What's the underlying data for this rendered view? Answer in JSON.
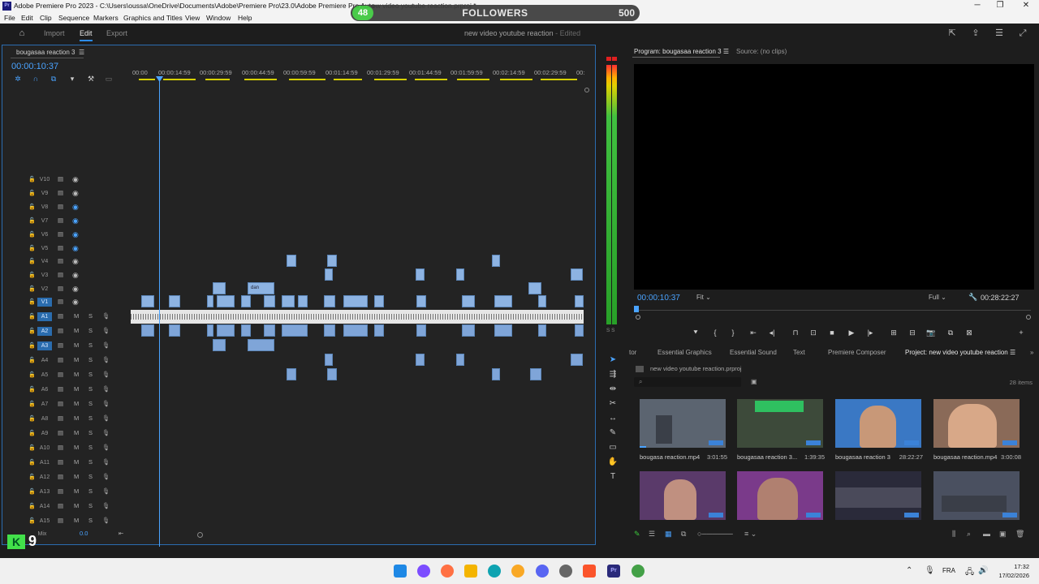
{
  "window": {
    "title": "Adobe Premiere Pro 2023 - C:\\Users\\oussa\\OneDrive\\Documents\\Adobe\\Premiere Pro\\23.0\\Adobe Premiere Pro Auto-",
    "title_tail": "ew video youtube reaction.prproj *",
    "app_icon": "Pr"
  },
  "menu": [
    "File",
    "Edit",
    "Clip",
    "Sequence",
    "Markers",
    "Graphics and Titles",
    "View",
    "Window",
    "Help"
  ],
  "overlay": {
    "followers_count": "48",
    "followers_label": "FOLLOWERS",
    "followers_goal": "500",
    "badge_letter": "K",
    "badge_number": "9"
  },
  "header": {
    "nav": [
      "Import",
      "Edit",
      "Export"
    ],
    "project_name": "new video youtube reaction",
    "project_status": "- Edited"
  },
  "timeline": {
    "sequence_tab": "bougasaa reaction 3",
    "timecode": "00:00:10:37",
    "ruler_ticks": [
      "00:00",
      "00:00:14:59",
      "00:00:29:59",
      "00:00:44:59",
      "00:00:59:59",
      "00:01:14:59",
      "00:01:29:59",
      "00:01:44:59",
      "00:01:59:59",
      "00:02:14:59",
      "00:02:29:59",
      "00:"
    ],
    "video_tracks": [
      "V10",
      "V9",
      "V8",
      "V7",
      "V6",
      "V5",
      "V4",
      "V3",
      "V2",
      "V1"
    ],
    "audio_tracks": [
      "A1",
      "A2",
      "A3",
      "A4",
      "A5",
      "A6",
      "A7",
      "A8",
      "A9",
      "A10",
      "A11",
      "A12",
      "A13",
      "A14",
      "A15"
    ],
    "mix_label": "Mix",
    "mix_value": "0.0",
    "clip_label": "dan",
    "mute_label": "M",
    "solo_label": "S"
  },
  "meter": {
    "label": "S S"
  },
  "program": {
    "tab_program": "Program: bougasaa reaction 3",
    "tab_source": "Source: (no clips)",
    "timecode": "00:00:10:37",
    "fit": "Fit",
    "resolution": "Full",
    "duration": "00:28:22:27"
  },
  "project": {
    "tabs": [
      "tor",
      "Essential Graphics",
      "Essential Sound",
      "Text",
      "Premiere Composer",
      "Project: new video youtube reaction"
    ],
    "path": "new video youtube reaction.prproj",
    "items_count": "28 items",
    "search_placeholder": "",
    "thumbnails": [
      {
        "name": "bougasa reaction.mp4",
        "duration": "3:01:55",
        "color": "#5b6470"
      },
      {
        "name": "bougasaa reaction 3...",
        "duration": "1:39:35",
        "color": "#3d4a3a"
      },
      {
        "name": "bougasaa reaction 3",
        "duration": "28:22:27",
        "color": "#3a78c4"
      },
      {
        "name": "bougasaa reaction.mp4",
        "duration": "3:00:08",
        "color": "#8a6a58"
      },
      {
        "name": "",
        "duration": "",
        "color": "#5a3a6a"
      },
      {
        "name": "",
        "duration": "",
        "color": "#7a3a8a"
      },
      {
        "name": "",
        "duration": "",
        "color": "#2a2a3a"
      },
      {
        "name": "",
        "duration": "",
        "color": "#4a5060"
      }
    ]
  },
  "taskbar": {
    "language": "FRA",
    "time": "17:32",
    "date": "17/02/2026"
  },
  "colors": {
    "accent": "#4aa3ff",
    "clip_video": "#8db3e2",
    "clip_audio": "#7fa5d8",
    "panel_bg": "#232323",
    "followers_green": "#3cc83c"
  }
}
